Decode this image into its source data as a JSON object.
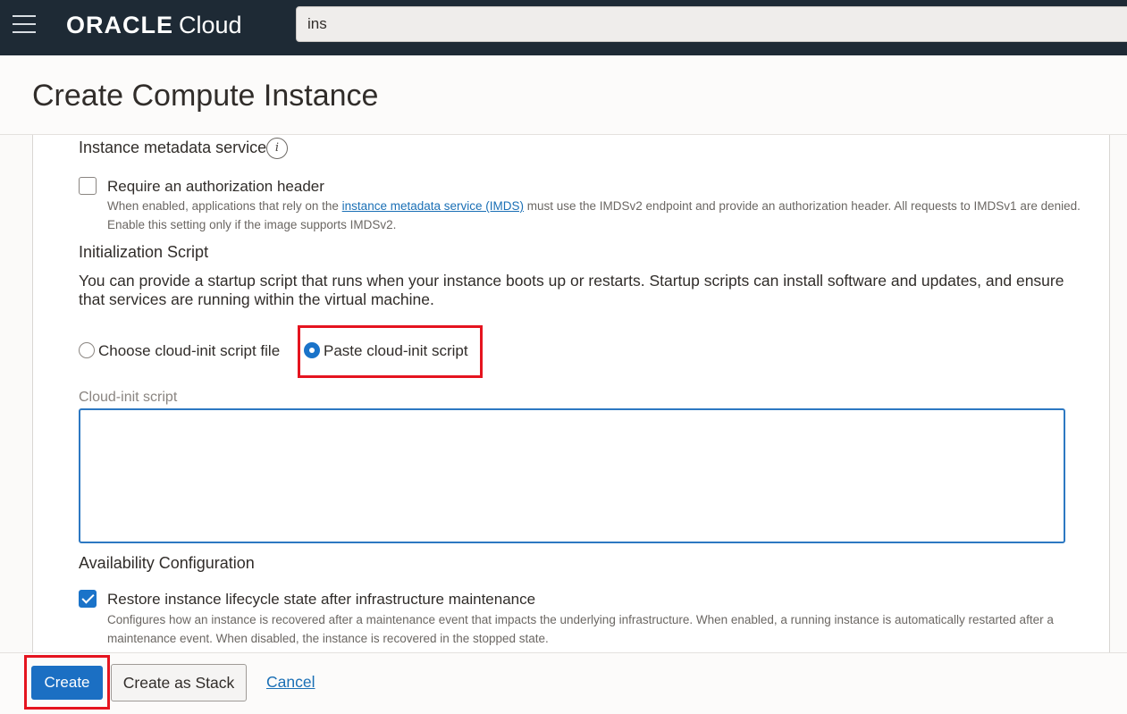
{
  "header": {
    "brand": "ORACLE",
    "product": "Cloud",
    "search_value": "ins"
  },
  "page": {
    "title": "Create Compute Instance"
  },
  "metadata_section": {
    "title": "Instance metadata service",
    "info_icon": "i",
    "auth_checkbox": {
      "label": "Require an authorization header",
      "checked": false,
      "help_before": "When enabled, applications that rely on the ",
      "help_link": "instance metadata service (IMDS)",
      "help_after": " must use the IMDSv2 endpoint and provide an authorization header. All requests to IMDSv1 are denied. Enable this setting only if the image supports IMDSv2."
    }
  },
  "init_section": {
    "title": "Initialization Script",
    "description": "You can provide a startup script that runs when your instance boots up or restarts. Startup scripts can install software and updates, and ensure that services are running within the virtual machine.",
    "options": [
      {
        "label": "Choose cloud-init script file",
        "selected": false
      },
      {
        "label": "Paste cloud-init script",
        "selected": true
      }
    ],
    "script_label": "Cloud-init script",
    "script_value": ""
  },
  "availability_section": {
    "title": "Availability Configuration",
    "restore_checkbox": {
      "label": "Restore instance lifecycle state after infrastructure maintenance",
      "checked": true,
      "help": "Configures how an instance is recovered after a maintenance event that impacts the underlying infrastructure. When enabled, a running instance is automatically restarted after a maintenance event. When disabled, the instance is recovered in the stopped state."
    }
  },
  "footer": {
    "create_label": "Create",
    "stack_label": "Create as Stack",
    "cancel_label": "Cancel"
  },
  "colors": {
    "topbar": "#1e2a35",
    "primary": "#1b6fc3",
    "highlight": "#e5141f",
    "link": "#1a6fb5"
  }
}
